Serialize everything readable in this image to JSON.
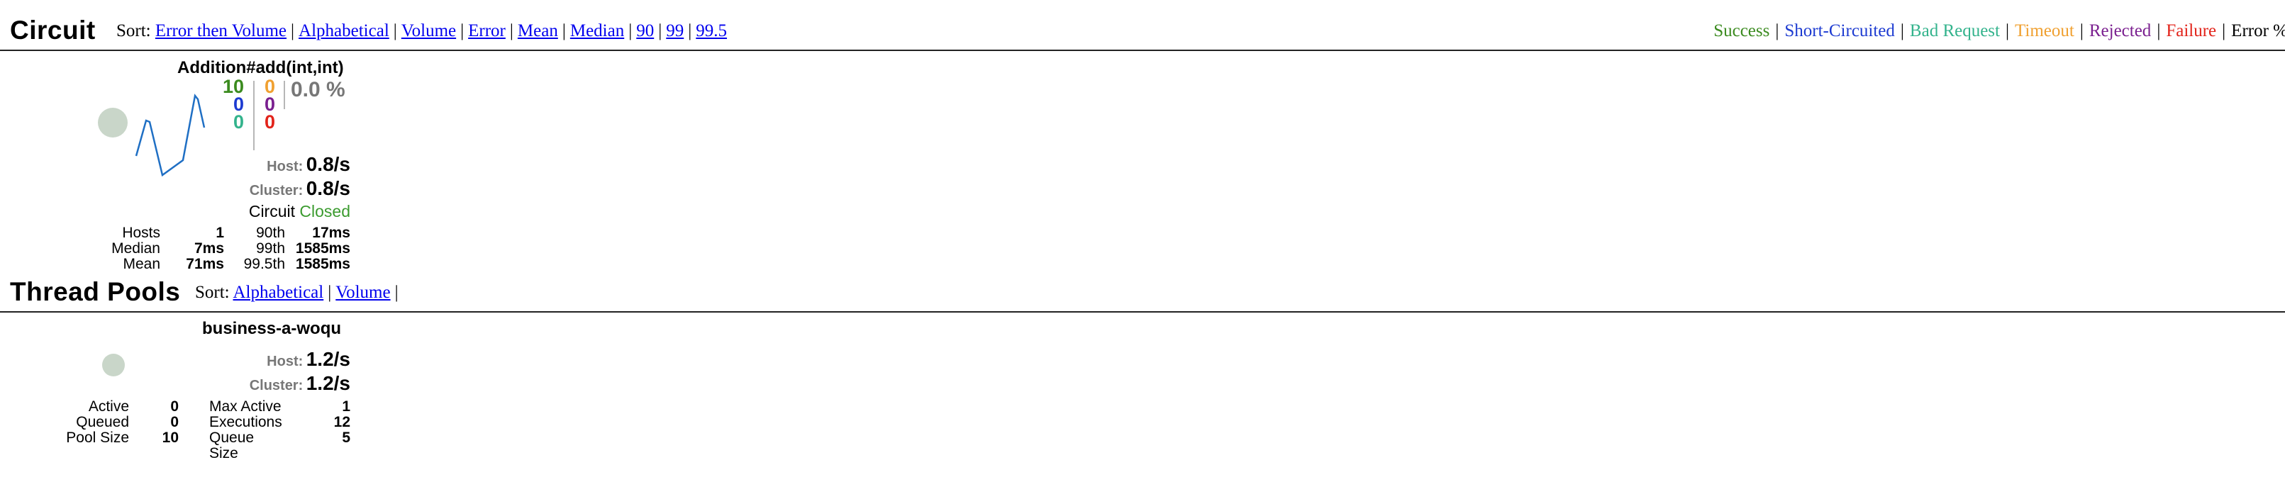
{
  "circuit": {
    "title": "Circuit",
    "sort_label": "Sort:",
    "sort_links": [
      "Error then Volume",
      "Alphabetical",
      "Volume",
      "Error",
      "Mean",
      "Median",
      "90",
      "99",
      "99.5"
    ],
    "legend": [
      {
        "label": "Success",
        "color": "#3b8b1f"
      },
      {
        "label": "Short-Circuited",
        "color": "#1d3bd1"
      },
      {
        "label": "Bad Request",
        "color": "#33b38c"
      },
      {
        "label": "Timeout",
        "color": "#f0a030"
      },
      {
        "label": "Rejected",
        "color": "#7a1f8f"
      },
      {
        "label": "Failure",
        "color": "#e2231a"
      },
      {
        "label": "Error %",
        "color": "#000000"
      }
    ],
    "card": {
      "name": "Addition#add(int,int)",
      "counts_left": [
        "10",
        "0",
        "0"
      ],
      "counts_right": [
        "0",
        "0",
        "0"
      ],
      "error_pct": "0.0 %",
      "host_label": "Host:",
      "host_rate": "0.8/s",
      "cluster_label": "Cluster:",
      "cluster_rate": "0.8/s",
      "circuit_label": "Circuit",
      "circuit_status": "Closed",
      "stats": [
        {
          "label": "Hosts",
          "value": "1",
          "plabel": "90th",
          "pvalue": "17ms"
        },
        {
          "label": "Median",
          "value": "7ms",
          "plabel": "99th",
          "pvalue": "1585ms"
        },
        {
          "label": "Mean",
          "value": "71ms",
          "plabel": "99.5th",
          "pvalue": "1585ms"
        }
      ]
    }
  },
  "thread_pools": {
    "title": "Thread Pools",
    "sort_label": "Sort:",
    "sort_links": [
      "Alphabetical",
      "Volume"
    ],
    "card": {
      "name": "business-a-woqu",
      "host_label": "Host:",
      "host_rate": "1.2/s",
      "cluster_label": "Cluster:",
      "cluster_rate": "1.2/s",
      "stats": [
        {
          "label": "Active",
          "value": "0",
          "plabel": "Max Active",
          "pvalue": "1"
        },
        {
          "label": "Queued",
          "value": "0",
          "plabel": "Executions",
          "pvalue": "12"
        },
        {
          "label": "Pool Size",
          "value": "10",
          "plabel": "Queue Size",
          "pvalue": "5"
        }
      ]
    }
  }
}
